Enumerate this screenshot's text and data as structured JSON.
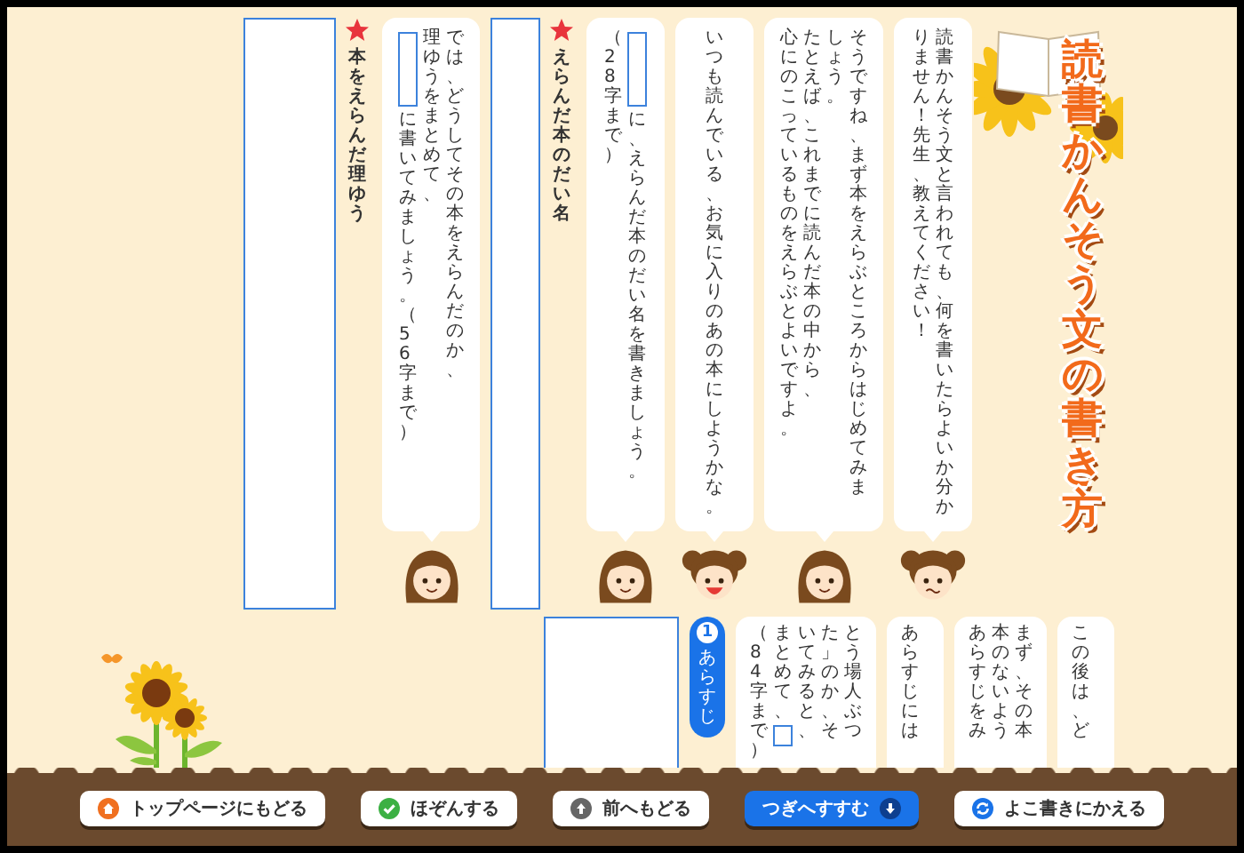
{
  "title": "読書かんそう文の書き方",
  "steps": [
    {
      "kind": "entry",
      "heading": "本をえらんだ理ゆう",
      "required": true
    },
    {
      "kind": "bubble",
      "face": {
        "kind": "teacher-smile"
      },
      "columns": [
        {
          "kind": "field-text",
          "text": "に書いてみましょう。（56字まで）"
        },
        {
          "kind": "text",
          "text": "理ゆうをまとめて、"
        },
        {
          "kind": "text",
          "text": "では、どうしてその本をえらんだのか、"
        }
      ]
    },
    {
      "kind": "entry",
      "heading": "えらんだ本のだい名",
      "required": true
    },
    {
      "kind": "bubble",
      "face": {
        "kind": "teacher-smile"
      },
      "columns": [
        {
          "kind": "text",
          "text": "（28字まで）"
        },
        {
          "kind": "field-text",
          "text": "に、えらんだ本のだい名を書きましょう。"
        }
      ]
    },
    {
      "kind": "bubble",
      "face": {
        "kind": "student-laugh"
      },
      "columns": [
        {
          "kind": "text",
          "text": "いつも読んでいる、お気に入りのあの本にしようかな。"
        }
      ]
    },
    {
      "kind": "bubble",
      "face": {
        "kind": "teacher-smile"
      },
      "columns": [
        {
          "kind": "text",
          "text": "心にのこっているものをえらぶとよいですよ。"
        },
        {
          "kind": "text",
          "text": "たとえば、これまでに読んだ本の中から、"
        },
        {
          "kind": "text",
          "text": "しょう。"
        },
        {
          "kind": "text",
          "text": "そうですね、まず本をえらぶところからはじめてみま"
        }
      ]
    },
    {
      "kind": "bubble",
      "face": {
        "kind": "student-worried"
      },
      "columns": [
        {
          "kind": "text",
          "text": "りません！先生、教えてください！"
        },
        {
          "kind": "text",
          "text": "読書かんそう文と言われても、何を書いたらよいか分か"
        }
      ]
    }
  ],
  "bottom": {
    "badge": {
      "number": "1",
      "label": "あらすじ"
    },
    "bubbles": [
      {
        "columns": [
          {
            "kind": "text",
            "text": "（84字まで）"
          },
          {
            "kind": "text-field",
            "text": "まとめて、"
          },
          {
            "kind": "text",
            "text": "いてみると、"
          },
          {
            "kind": "text",
            "text": "た」のか、そ"
          },
          {
            "kind": "text",
            "text": "とう場人ぶつ"
          }
        ]
      },
      {
        "columns": [
          {
            "kind": "text",
            "text": "あらすじには"
          }
        ]
      },
      {
        "columns": [
          {
            "kind": "text",
            "text": "あらすじをみ"
          },
          {
            "kind": "text",
            "text": "本のないよう"
          },
          {
            "kind": "text",
            "text": "まず、その本"
          }
        ]
      },
      {
        "columns": [
          {
            "kind": "text",
            "text": "この後は、ど"
          }
        ]
      }
    ]
  },
  "buttons": [
    {
      "kind": "home",
      "label": "トップページにもどる",
      "primary": false,
      "icon_after": false
    },
    {
      "kind": "check",
      "label": "ほぞんする",
      "primary": false,
      "icon_after": false
    },
    {
      "kind": "up",
      "label": "前へもどる",
      "primary": false,
      "icon_after": false
    },
    {
      "kind": "down",
      "label": "つぎへすすむ",
      "primary": true,
      "icon_after": true
    },
    {
      "kind": "swap",
      "label": "よこ書きにかえる",
      "primary": false,
      "icon_after": false
    }
  ]
}
